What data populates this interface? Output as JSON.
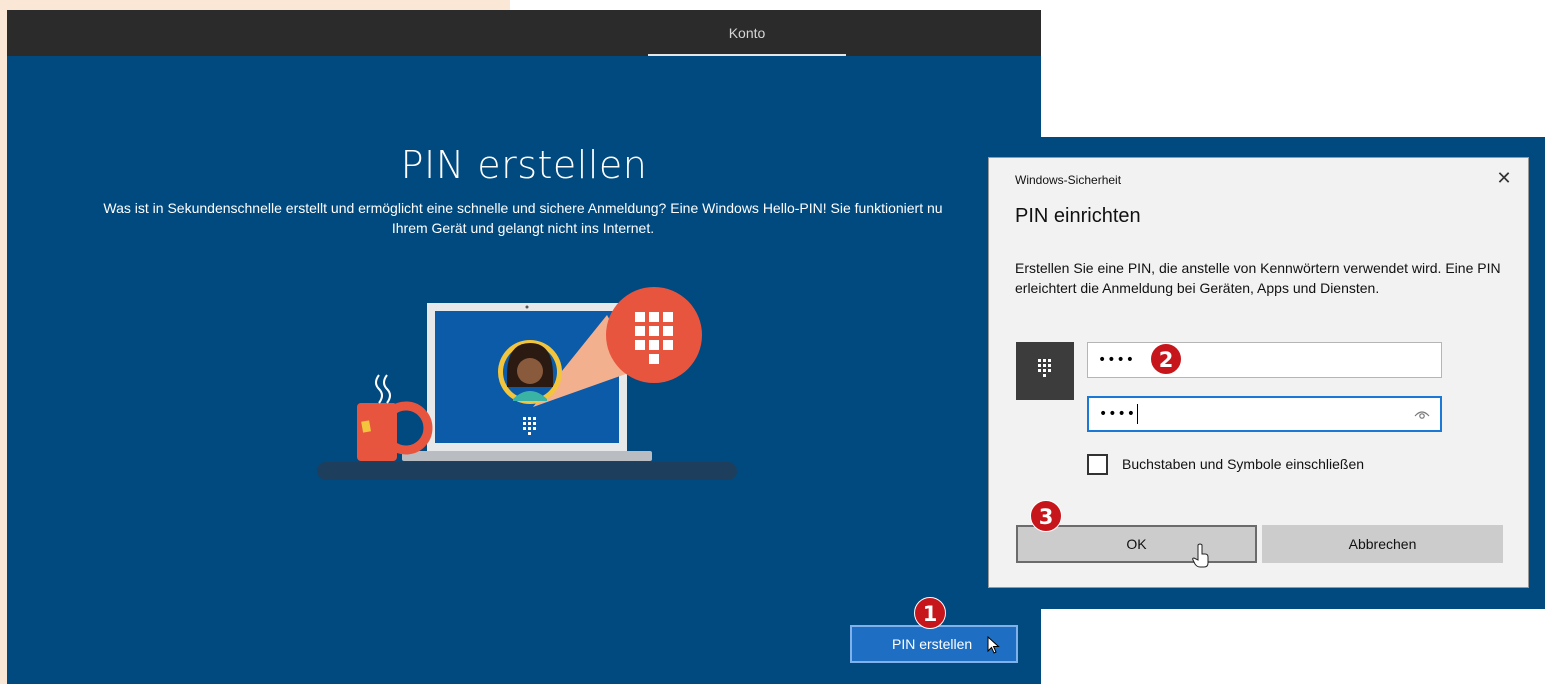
{
  "background": {
    "left_panel_color": "#fbe7d6",
    "window_color": "#014a7f",
    "topbar_color": "#2b2b2b"
  },
  "topbar": {
    "tab_label": "Konto"
  },
  "main": {
    "title": "PIN erstellen",
    "description_line1": "Was ist in Sekundenschnelle erstellt und ermöglicht eine schnelle und sichere Anmeldung? Eine Windows Hello-PIN! Sie funktioniert nu",
    "description_line2": "Ihrem Gerät und gelangt nicht ins Internet.",
    "create_button_label": "PIN erstellen"
  },
  "badges": {
    "step1": "1",
    "step2": "2",
    "step3": "3",
    "color": "#c6161c"
  },
  "dialog": {
    "subtitle": "Windows-Sicherheit",
    "close_label": "✕",
    "title": "PIN einrichten",
    "text": "Erstellen Sie eine PIN, die anstelle von Kennwörtern verwendet wird. Eine PIN erleichtert die Anmeldung bei Geräten, Apps und Diensten.",
    "pin_value": "••••",
    "confirm_pin_value": "••••",
    "include_letters_label": "Buchstaben und Symbole einschließen",
    "include_letters_checked": false,
    "ok_label": "OK",
    "cancel_label": "Abbrechen"
  },
  "icons": [
    "keypad-icon",
    "eye-icon",
    "mouse-cursor-icon",
    "laptop-illustration",
    "coffee-mug-illustration",
    "avatar-illustration"
  ]
}
